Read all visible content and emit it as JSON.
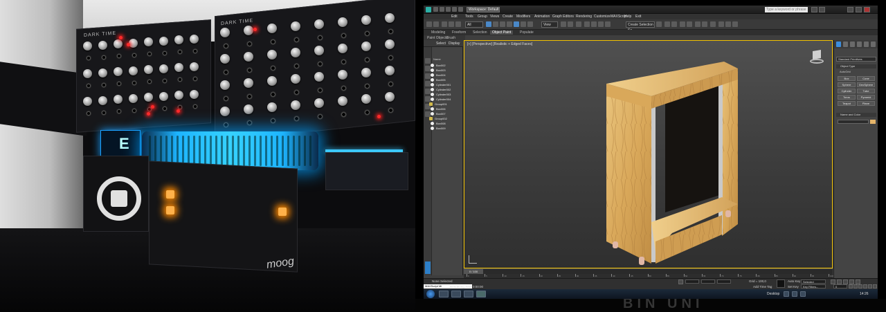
{
  "window": {
    "workspace": "Workspace: Default",
    "search_placeholder": "Type a keyword or phrase"
  },
  "menu": [
    "Edit",
    "Tools",
    "Group",
    "Views",
    "Create",
    "Modifiers",
    "Animation",
    "Graph Editors",
    "Rendering",
    "Customize",
    "MAXScript",
    "Help",
    "Exit"
  ],
  "toolbar": {
    "selection_filter": "All",
    "view_dropdown": "View",
    "named_selection": "Create Selection Se"
  },
  "ribbon": {
    "tabs": [
      "Modeling",
      "Freeform",
      "Selection",
      "Object Paint",
      "Populate"
    ],
    "active_tab": "Object Paint",
    "sub": [
      "Paint Objects",
      "Brush Settings"
    ]
  },
  "explorer": {
    "tabs": [
      "Select",
      "Display"
    ],
    "header": "Name",
    "rows": [
      {
        "name": "Box002",
        "kind": "object"
      },
      {
        "name": "Box003",
        "kind": "object"
      },
      {
        "name": "Box004",
        "kind": "object"
      },
      {
        "name": "Box005",
        "kind": "object"
      },
      {
        "name": "Cylinder001",
        "kind": "object"
      },
      {
        "name": "Cylinder002",
        "kind": "object"
      },
      {
        "name": "Cylinder003",
        "kind": "object"
      },
      {
        "name": "Cylinder004",
        "kind": "object"
      },
      {
        "name": "Group001",
        "kind": "group"
      },
      {
        "name": "Box006",
        "kind": "object"
      },
      {
        "name": "Box007",
        "kind": "object"
      },
      {
        "name": "Group002",
        "kind": "group"
      },
      {
        "name": "Box008",
        "kind": "object"
      },
      {
        "name": "Box009",
        "kind": "object"
      }
    ]
  },
  "viewport": {
    "label": "[+] [Perspective] [Realistic + Edged Faces]"
  },
  "timeline": {
    "slider": "0 / 100",
    "ticks": [
      "0",
      "5",
      "10",
      "15",
      "20",
      "25",
      "30",
      "35",
      "40",
      "45",
      "50",
      "55",
      "60",
      "65",
      "70",
      "75",
      "80",
      "85",
      "90",
      "95",
      "100"
    ]
  },
  "status": {
    "script_listener": "MAXScript Mi",
    "selection": "None Selected",
    "prompt": "Rendering Time 0:00:00",
    "grid": "Grid = 100,0",
    "auto_key": "Auto Key",
    "set_key": "Set Key",
    "key_mode": "Selected",
    "key_filters": "Key Filters...",
    "add_time_tag": "Add Time Tag",
    "frame": "0"
  },
  "command_panel": {
    "dropdown": "Standard Primitives",
    "object_type_header": "Object Type",
    "autogrid": "AutoGrid",
    "buttons": [
      "Box",
      "Cone",
      "Sphere",
      "GeoSphere",
      "Cylinder",
      "Tube",
      "Torus",
      "Pyramid",
      "Teapot",
      "Plane"
    ],
    "name_color_header": "Name and Color"
  },
  "taskbar": {
    "desktop": "Desktop",
    "clock": "14:26"
  },
  "photo": {
    "panel_label_left": "DARK TIME",
    "panel_label_right": "DARK TIME",
    "brand": "moog"
  }
}
